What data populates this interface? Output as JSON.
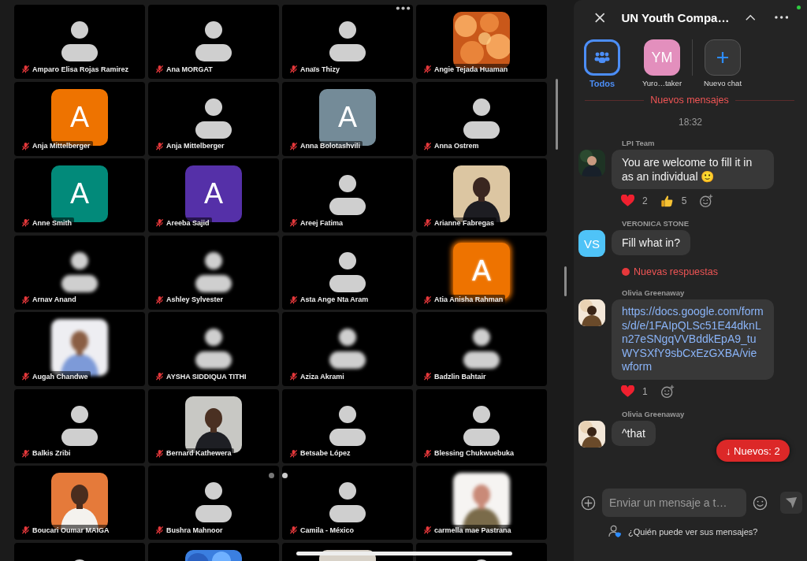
{
  "gallery": {
    "tiles": [
      {
        "name": "Amparo Elisa Rojas Ramirez",
        "kind": "silhouette",
        "muted": true,
        "blurred": false
      },
      {
        "name": "Ana MORGAT",
        "kind": "silhouette",
        "muted": true,
        "blurred": false
      },
      {
        "name": "Anaïs Thizy",
        "kind": "silhouette",
        "muted": true,
        "blurred": false
      },
      {
        "name": "Angie Tejada Huaman",
        "kind": "picture",
        "muted": true,
        "blurred": false
      },
      {
        "name": "Anja Mittelberger",
        "kind": "letter",
        "letter": "A",
        "color": "#ee7300",
        "muted": true,
        "blurred": false
      },
      {
        "name": "Anja Mittelberger",
        "kind": "silhouette",
        "muted": true,
        "blurred": false
      },
      {
        "name": "Anna Bolotashvili",
        "kind": "letter",
        "letter": "A",
        "color": "#748b98",
        "muted": true,
        "blurred": false
      },
      {
        "name": "Anna Ostrem",
        "kind": "silhouette",
        "muted": true,
        "blurred": false
      },
      {
        "name": "Anne Smith",
        "kind": "letter",
        "letter": "A",
        "color": "#028a7a",
        "muted": true,
        "blurred": false
      },
      {
        "name": "Areeba Sajid",
        "kind": "letter",
        "letter": "A",
        "color": "#5530a8",
        "muted": true,
        "blurred": false
      },
      {
        "name": "Areej Fatima",
        "kind": "silhouette",
        "muted": true,
        "blurred": false
      },
      {
        "name": "Arianne Fabregas",
        "kind": "picture",
        "muted": true,
        "blurred": false
      },
      {
        "name": "Arnav Anand",
        "kind": "silhouette",
        "muted": true,
        "blurred": true
      },
      {
        "name": "Ashley Sylvester",
        "kind": "silhouette",
        "muted": true,
        "blurred": true
      },
      {
        "name": "Asta Ange Nta Aram",
        "kind": "silhouette",
        "muted": true,
        "blurred": false
      },
      {
        "name": "Atia Anisha Rahman",
        "kind": "letter",
        "letter": "A",
        "color": "#ee7300",
        "muted": true,
        "blurred": true
      },
      {
        "name": "Augah Chandwe",
        "kind": "picture",
        "muted": true,
        "blurred": true
      },
      {
        "name": "AYSHA SIDDIQUA TITHI",
        "kind": "silhouette",
        "muted": true,
        "blurred": true
      },
      {
        "name": "Aziza Akrami",
        "kind": "silhouette",
        "muted": true,
        "blurred": true
      },
      {
        "name": "Badzlin Bahtair",
        "kind": "silhouette",
        "muted": true,
        "blurred": true
      },
      {
        "name": "Balkis Zribi",
        "kind": "silhouette",
        "muted": true,
        "blurred": false
      },
      {
        "name": "Bernard Kathewera",
        "kind": "picture",
        "muted": true,
        "blurred": false
      },
      {
        "name": "Betsabe López",
        "kind": "silhouette",
        "muted": true,
        "blurred": false
      },
      {
        "name": "Blessing Chukwuebuka",
        "kind": "silhouette",
        "muted": true,
        "blurred": false
      },
      {
        "name": "Boucari Oumar MAIGA",
        "kind": "picture",
        "muted": true,
        "blurred": false
      },
      {
        "name": "Bushra Mahnoor",
        "kind": "silhouette",
        "muted": true,
        "blurred": false
      },
      {
        "name": "Camila - México",
        "kind": "silhouette",
        "muted": true,
        "blurred": false
      },
      {
        "name": "carmella mae Pastrana",
        "kind": "picture",
        "muted": true,
        "blurred": true
      },
      {
        "kind": "silhouette",
        "blurred": false
      },
      {
        "kind": "picture",
        "blurred": false
      },
      {
        "kind": "picture",
        "blurred": false
      },
      {
        "kind": "silhouette",
        "blurred": false
      }
    ],
    "pager": [
      {
        "selected": false
      },
      {
        "selected": true
      }
    ]
  },
  "chat": {
    "title": "UN Youth Compa…",
    "online": true,
    "recipients": [
      {
        "label": "Todos",
        "kind": "group",
        "selected": true
      },
      {
        "label": "Yuro…taker",
        "kind": "initials",
        "initials": "YM",
        "color": "#e38fbd",
        "selected": false
      },
      {
        "label": "Nuevo chat",
        "kind": "new",
        "selected": false
      }
    ],
    "new_messages_divider": "Nuevos mensajes",
    "time": "18:32",
    "messages": [
      {
        "sender": "LPI Team",
        "avatar": {
          "kind": "picture"
        },
        "kind": "text",
        "text": "You are welcome to fill it in as an individual 🙂",
        "reactions": [
          {
            "kind": "heart",
            "count": "2"
          },
          {
            "kind": "thumbs_up",
            "count": "5"
          }
        ]
      },
      {
        "sender": "VERONICA STONE",
        "avatar": {
          "kind": "initials",
          "initials": "VS",
          "color": "#4fc3f7"
        },
        "kind": "text",
        "text": "Fill what in?",
        "new_replies": "Nuevas respuestas"
      },
      {
        "sender": "Olivia Greenaway",
        "avatar": {
          "kind": "picture"
        },
        "kind": "link",
        "text": "https://docs.google.com/forms/d/e/1FAIpQLSc51E44dknLn27eSNgqVVBddkEpA9_tuWYSXfY9sbCxEzGXBA/viewform",
        "reactions": [
          {
            "kind": "heart",
            "count": "1"
          }
        ]
      },
      {
        "sender": "Olivia Greenaway",
        "avatar": {
          "kind": "picture"
        },
        "kind": "text",
        "text": "^that"
      }
    ],
    "jump_button": "↓ Nuevos: 2",
    "composer": {
      "placeholder": "Enviar un mensaje a t…",
      "send_disabled": true
    },
    "privacy_note": "¿Quién puede ver sus mensajes?"
  }
}
